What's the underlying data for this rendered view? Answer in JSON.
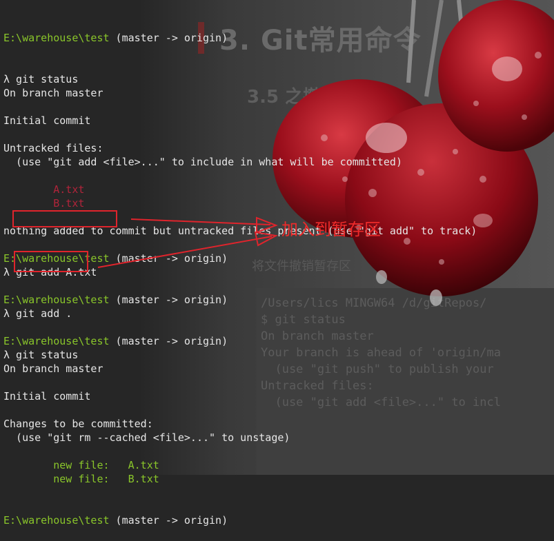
{
  "background": {
    "slide_heading": "3. Git常用命令",
    "slide_subheading": "3.5 之撤销",
    "slide_caption": "将文件撤销暂存区",
    "code_lines": [
      "/Users/lics MINGW64 /d/gitRepos/",
      "$ git status",
      "On branch master",
      "Your branch is ahead of 'origin/ma",
      "  (use \"git push\" to publish your",
      "Untracked files:",
      "  (use \"git add <file>...\" to incl"
    ]
  },
  "terminal": {
    "lines": [
      {
        "type": "plain",
        "text": "λ git status"
      },
      {
        "type": "plain",
        "text": "On branch master"
      },
      {
        "type": "blank",
        "text": ""
      },
      {
        "type": "plain",
        "text": "Initial commit"
      },
      {
        "type": "blank",
        "text": ""
      },
      {
        "type": "plain",
        "text": "Untracked files:"
      },
      {
        "type": "plain",
        "text": "  (use \"git add <file>...\" to include in what will be committed)"
      },
      {
        "type": "blank",
        "text": ""
      },
      {
        "type": "untracked",
        "text": "        A.txt"
      },
      {
        "type": "untracked",
        "text": "        B.txt"
      },
      {
        "type": "blank",
        "text": ""
      },
      {
        "type": "plain",
        "text": "nothing added to commit but untracked files present (use \"git add\" to track)"
      },
      {
        "type": "blank",
        "text": ""
      },
      {
        "type": "prompt",
        "path": "E:\\warehouse\\test",
        "branch": " (master -> origin)"
      },
      {
        "type": "plain",
        "text": "λ git add A.txt"
      },
      {
        "type": "blank",
        "text": ""
      },
      {
        "type": "prompt",
        "path": "E:\\warehouse\\test",
        "branch": " (master -> origin)"
      },
      {
        "type": "plain",
        "text": "λ git add ."
      },
      {
        "type": "blank",
        "text": ""
      },
      {
        "type": "prompt",
        "path": "E:\\warehouse\\test",
        "branch": " (master -> origin)"
      },
      {
        "type": "plain",
        "text": "λ git status"
      },
      {
        "type": "plain",
        "text": "On branch master"
      },
      {
        "type": "blank",
        "text": ""
      },
      {
        "type": "plain",
        "text": "Initial commit"
      },
      {
        "type": "blank",
        "text": ""
      },
      {
        "type": "plain",
        "text": "Changes to be committed:"
      },
      {
        "type": "plain",
        "text": "  (use \"git rm --cached <file>...\" to unstage)"
      },
      {
        "type": "blank",
        "text": ""
      },
      {
        "type": "staged",
        "text": "        new file:   A.txt"
      },
      {
        "type": "staged",
        "text": "        new file:   B.txt"
      },
      {
        "type": "blank",
        "text": ""
      },
      {
        "type": "blank",
        "text": ""
      },
      {
        "type": "prompt",
        "path": "E:\\warehouse\\test",
        "branch": " (master -> origin)"
      }
    ],
    "first_prompt": {
      "path": "E:\\warehouse\\test",
      "branch": " (master -> origin)"
    }
  },
  "annotation": {
    "label": "加入到暂存区",
    "color": "#e0242c"
  },
  "colors": {
    "path": "#8ac62a",
    "untracked": "#b0243a",
    "staged": "#8ac62a",
    "text": "#e6e6e6"
  }
}
